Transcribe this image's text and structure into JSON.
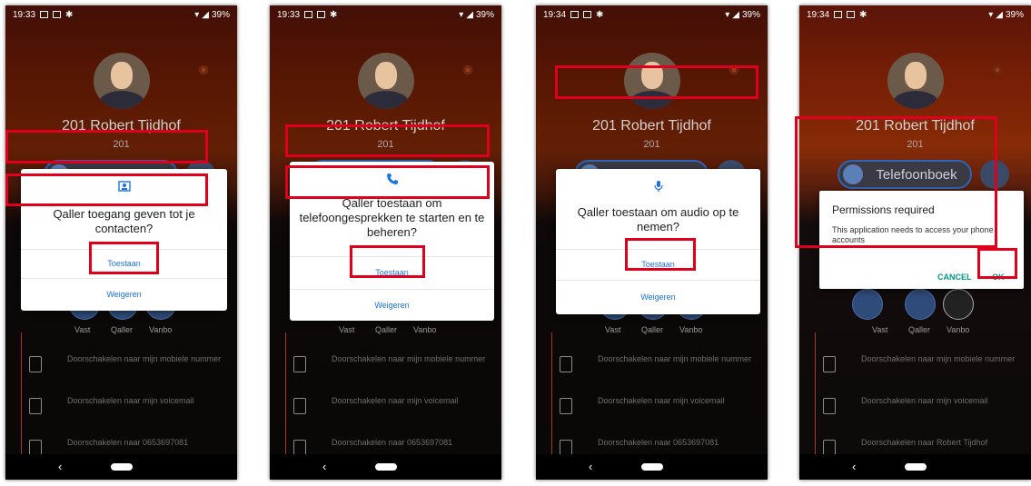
{
  "screens": [
    {
      "time": "19:33",
      "battery": "39%",
      "profile": {
        "name": "201 Robert Tijdhof",
        "number": "201"
      },
      "dialog": {
        "message": "Qaller toegang geven tot je contacten?",
        "allow": "Toestaan",
        "deny": "Weigeren",
        "icon": "contacts-icon"
      },
      "circle_labels": [
        "Vast",
        "Qaller",
        "Vanbo"
      ],
      "rows": [
        "Doorschakelen naar mijn mobiele nummer",
        "Doorschakelen naar mijn voicemail",
        "Doorschakelen naar 0653697081"
      ]
    },
    {
      "time": "19:33",
      "battery": "39%",
      "profile": {
        "name": "201 Robert Tijdhof",
        "number": "201"
      },
      "dialog": {
        "message": "Qaller toestaan om telefoongesprekken te starten en te beheren?",
        "allow": "Toestaan",
        "deny": "Weigeren",
        "icon": "phone-icon"
      },
      "circle_labels": [
        "Vast",
        "Qaller",
        "Vanbo"
      ],
      "rows": [
        "Doorschakelen naar mijn mobiele nummer",
        "Doorschakelen naar mijn voicemail",
        "Doorschakelen naar 0653697081"
      ]
    },
    {
      "time": "19:34",
      "battery": "39%",
      "profile": {
        "name": "201 Robert Tijdhof",
        "number": "201"
      },
      "dialog": {
        "message": "Qaller toestaan om audio op te nemen?",
        "allow": "Toestaan",
        "deny": "Weigeren",
        "icon": "microphone-icon"
      },
      "circle_labels": [
        "Vast",
        "Qaller",
        "Vanbo"
      ],
      "rows": [
        "Doorschakelen naar mijn mobiele nummer",
        "Doorschakelen naar mijn voicemail",
        "Doorschakelen naar 0653697081"
      ]
    },
    {
      "time": "19:34",
      "battery": "39%",
      "profile": {
        "name": "201 Robert Tijdhof",
        "number": "201"
      },
      "phonebook_label": "Telefoonboek",
      "permission": {
        "title": "Permissions required",
        "body": "This application needs to access your phone accounts",
        "cancel": "CANCEL",
        "ok": "OK"
      },
      "circle_labels": [
        "Vast",
        "Qaller",
        "Vanbo"
      ],
      "rows": [
        "Doorschakelen naar mijn mobiele nummer",
        "Doorschakelen naar mijn voicemail",
        "Doorschakelen naar Robert Tijdhof"
      ]
    }
  ],
  "colors": {
    "highlight": "#e0001b",
    "link": "#1a73e8",
    "accent": "#009688"
  }
}
